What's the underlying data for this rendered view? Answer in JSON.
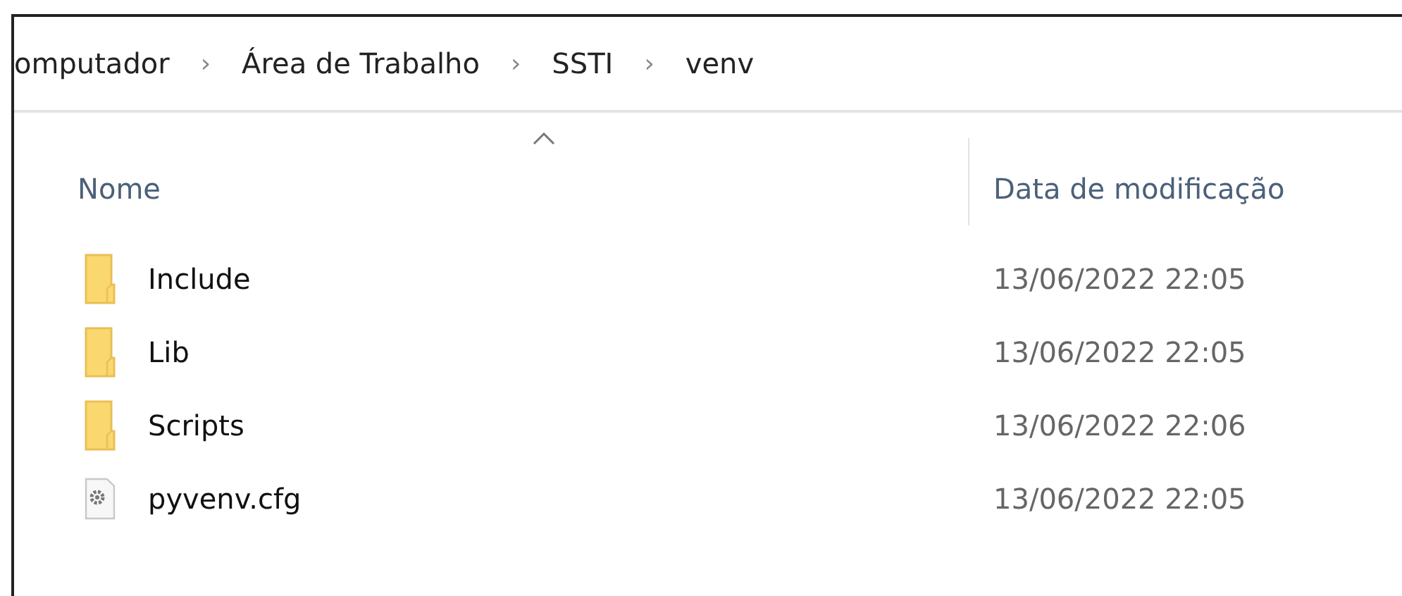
{
  "breadcrumb": [
    "omputador",
    "Área de Trabalho",
    "SSTI",
    "venv"
  ],
  "breadcrumb_separator": "›",
  "columns": [
    {
      "label": "Nome",
      "sorted": true
    },
    {
      "label": "Data de modificação",
      "sorted": false
    }
  ],
  "rows": [
    {
      "kind": "folder",
      "name": "Include",
      "modified": "13/06/2022 22:05"
    },
    {
      "kind": "folder",
      "name": "Lib",
      "modified": "13/06/2022 22:05"
    },
    {
      "kind": "folder",
      "name": "Scripts",
      "modified": "13/06/2022 22:06"
    },
    {
      "kind": "file",
      "name": "pyvenv.cfg",
      "modified": "13/06/2022 22:05"
    }
  ]
}
